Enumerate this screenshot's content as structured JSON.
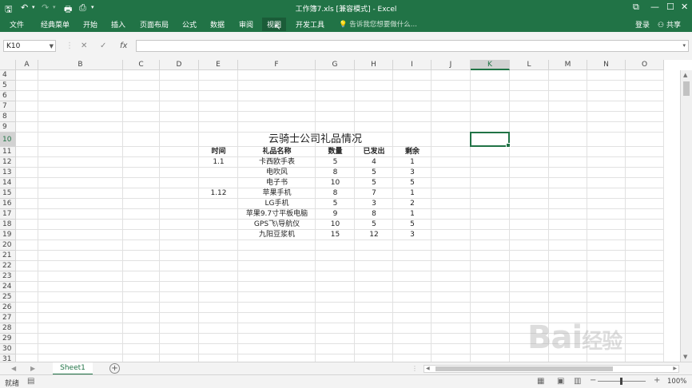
{
  "window": {
    "title": "工作簿7.xls  [兼容模式] - Excel",
    "controls": [
      "restore-icon",
      "minimize-icon",
      "maximize-icon",
      "close-icon"
    ]
  },
  "ribbon": {
    "tabs": [
      "文件",
      "经典菜单",
      "开始",
      "插入",
      "页面布局",
      "公式",
      "数据",
      "审阅",
      "视图",
      "开发工具"
    ],
    "active_tab": "视图",
    "tell_me": "告诉我您想要做什么...",
    "login": "登录",
    "share": "共享"
  },
  "formula_bar": {
    "name_box": "K10",
    "cancel_icon": "✕",
    "enter_icon": "✓",
    "fx": "fx",
    "value": ""
  },
  "grid": {
    "columns": [
      "A",
      "B",
      "C",
      "D",
      "E",
      "F",
      "G",
      "H",
      "I",
      "J",
      "K",
      "L",
      "M",
      "N",
      "O"
    ],
    "rows": [
      "4",
      "5",
      "6",
      "7",
      "8",
      "9",
      "10",
      "11",
      "12",
      "13",
      "14",
      "15",
      "16",
      "17",
      "18",
      "19",
      "20",
      "21",
      "22",
      "23",
      "24",
      "25",
      "26",
      "27",
      "28",
      "29",
      "30",
      "31"
    ],
    "selected_cell": "K10",
    "selected_column": "K",
    "selected_row": "10"
  },
  "sheet": {
    "title": "云骑士公司礼品情况",
    "headers": [
      "时间",
      "礼品名称",
      "数量",
      "已发出",
      "剩余"
    ],
    "rows": [
      [
        "1.1",
        "卡西欧手表",
        "5",
        "4",
        "1"
      ],
      [
        "",
        "电吹风",
        "8",
        "5",
        "3"
      ],
      [
        "",
        "电子书",
        "10",
        "5",
        "5"
      ],
      [
        "1.12",
        "苹果手机",
        "8",
        "7",
        "1"
      ],
      [
        "",
        "LG手机",
        "5",
        "3",
        "2"
      ],
      [
        "",
        "苹果9.7寸平板电脑",
        "9",
        "8",
        "1"
      ],
      [
        "",
        "GPS飞\\导航仪",
        "10",
        "5",
        "5"
      ],
      [
        "",
        "九阳豆浆机",
        "15",
        "12",
        "3"
      ]
    ]
  },
  "sheet_tabs": {
    "tabs": [
      "Sheet1"
    ],
    "add": "+"
  },
  "status": {
    "ready": "就绪",
    "zoom": "100%",
    "zoom_minus": "−",
    "zoom_plus": "+"
  },
  "watermark": {
    "text": "Bai",
    "sub": "经验"
  },
  "colors": {
    "accent": "#217346",
    "header_bg": "#f3f3f3",
    "gridline": "#e1e1e1"
  }
}
